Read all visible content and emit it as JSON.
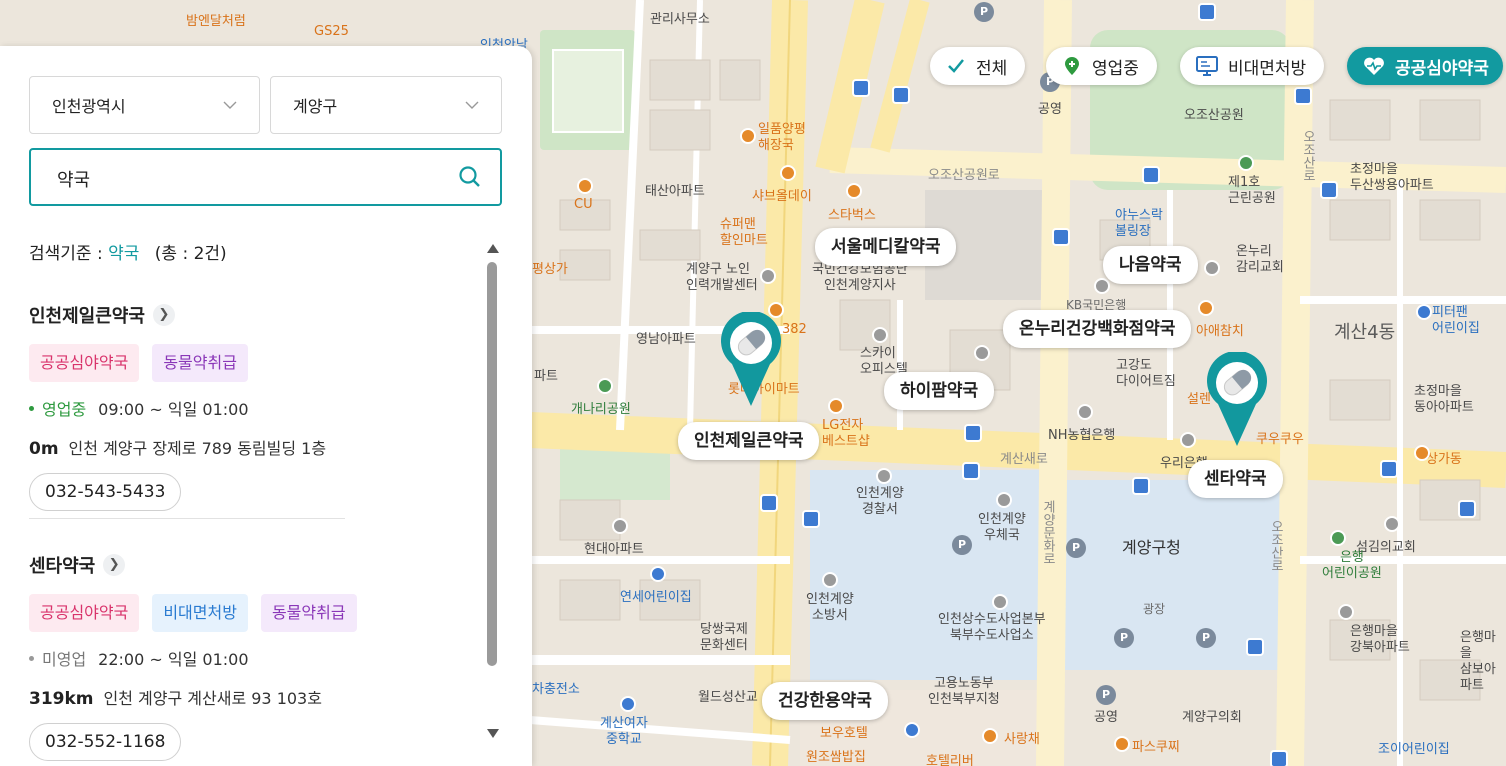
{
  "filters": [
    {
      "label": "전체",
      "icon": "check-icon",
      "active": false
    },
    {
      "label": "영업중",
      "icon": "location-pin-icon",
      "active": false
    },
    {
      "label": "비대면처방",
      "icon": "monitor-icon",
      "active": false
    },
    {
      "label": "공공심야약국",
      "icon": "heart-pulse-icon",
      "active": true
    }
  ],
  "panel": {
    "region_select": "인천광역시",
    "district_select": "계양구",
    "search_value": "약국",
    "criteria_label": "검색기준 : ",
    "criteria_keyword": "약국",
    "criteria_count": "(총 : 2건)"
  },
  "results": [
    {
      "name": "인천제일큰약국",
      "tags": [
        "공공심야약국",
        "동물약취급"
      ],
      "status": "영업중",
      "hours": "09:00 ~ 익일 01:00",
      "distance": "0m",
      "address": "인천 계양구 장제로 789 동림빌딩 1층",
      "phone": "032-543-5433"
    },
    {
      "name": "센타약국",
      "tags": [
        "공공심야약국",
        "비대면처방",
        "동물약취급"
      ],
      "status": "미영업",
      "hours": "22:00 ~ 익일 01:00",
      "distance": "319km",
      "address": "인천 계양구 계산새로 93 103호",
      "phone": "032-552-1168"
    }
  ],
  "map_pharmacies": [
    "서울메디칼약국",
    "나음약국",
    "온누리건강백화점약국",
    "하이팜약국",
    "인천제일큰약국",
    "센타약국",
    "건강한용약국"
  ],
  "map_labels": {
    "a1": "관리사무소",
    "a2": "인천안남",
    "a3": "일품양평\n해장국",
    "a4": "태산아파트",
    "a5": "샤브올데이",
    "a6": "슈퍼맨\n할인마트",
    "a7": "계양구 노인\n인력개발센터",
    "a8": "국민건강보험공단\n인천계양지사",
    "a9": "스타벅스",
    "a10": "오조산공원로",
    "a11": "오조산공원",
    "a12": "제1호\n근린공원",
    "a13": "야누스락\n볼링장",
    "a14": "온누리\n감리교회",
    "a15": "KB국민은행",
    "a16": "영남아파트",
    "a17": "스카이\n오피스텔",
    "a18": "개나리공원",
    "a19": "LG전자\n베스트샵",
    "a20": "고강도\n다이어트짐",
    "a21": "NH농협은행",
    "a22": "우리은행",
    "a23": "쿠우쿠우",
    "a24": "계산4동",
    "a25": "피터팬\n어린이집",
    "a26": "초정마을\n동아아파트",
    "a27": "초정마을\n두산쌍용아파트",
    "a28": "상가동",
    "a29": "인천계양\n경찰서",
    "a30": "인천계양\n우체국",
    "a31": "계양구청",
    "a32": "현대아파트",
    "a33": "연세어린이집",
    "a34": "인천계양\n소방서",
    "a35": "인천상수도사업본부\n북부수도사업소",
    "a36": "광장",
    "a37": "당쌍국제\n문화센터",
    "a38": "고용노동부\n인천북부지청",
    "a39": "월드성산교",
    "a40": "계산여자\n중학교",
    "a41": "차충전소",
    "a42": "보우호텔",
    "a43": "호텔리버",
    "a44": "사랑채",
    "a45": "파스쿠찌",
    "a46": "공영",
    "a47": "계양구의회",
    "a48": "섬김의교회",
    "a49": "은행\n어린이공원",
    "a50": "은행마을\n강북아파트",
    "a51": "은행마을\n삼보아파트",
    "a52": "조이어린이집",
    "a53": "오조산로",
    "a54": "계산새로",
    "a55": "계양문화로",
    "a56": "GS25",
    "a57": "밤엔달처럼",
    "a58": "원조쌈밥집",
    "a59": "아애참치",
    "a60": "롯데하이마트",
    "a61": "CU",
    "a62": "평상가",
    "a63": "파트",
    "a64": "설렌",
    "a65": "공영",
    "a66": "382",
    "a67": "오조산로"
  }
}
